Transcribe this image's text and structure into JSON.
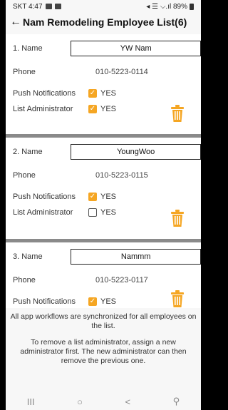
{
  "status": {
    "time": "SKT 4:47",
    "right": "◂ ☰ ⌵.ıl 89%"
  },
  "header": {
    "back_glyph": "←",
    "title": "Nam Remodeling Employee List(6)"
  },
  "employees": [
    {
      "name_label": "1. Name",
      "name": "YW Nam",
      "phone_label": "Phone",
      "phone": "010-5223-0114",
      "push_label": "Push Notifications",
      "push_checked": true,
      "push_text": "YES",
      "admin_label": "List Administrator",
      "admin_checked": true,
      "admin_text": "YES"
    },
    {
      "name_label": "2. Name",
      "name": "YoungWoo",
      "phone_label": "Phone",
      "phone": "010-5223-0115",
      "push_label": "Push Notifications",
      "push_checked": true,
      "push_text": "YES",
      "admin_label": "List Administrator",
      "admin_checked": false,
      "admin_text": "YES"
    },
    {
      "name_label": "3. Name",
      "name": "Nammm",
      "phone_label": "Phone",
      "phone": "010-5223-0117",
      "push_label": "Push Notifications",
      "push_checked": true,
      "push_text": "YES"
    }
  ],
  "notice": {
    "line1": "All app workflows are synchronized for all employees on the list.",
    "line2": "To remove a list administrator, assign a new administrator first. The new administrator can then remove the previous one."
  },
  "nav": {
    "recent": "III",
    "home": "○",
    "back": "<",
    "accessibility": "⚲"
  },
  "colors": {
    "accent": "#f5a623"
  }
}
